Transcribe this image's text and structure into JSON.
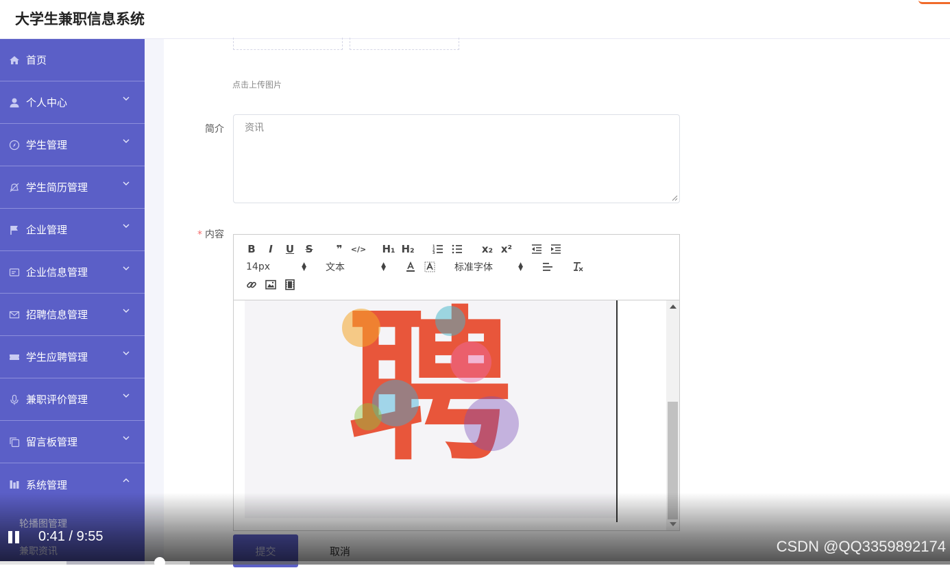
{
  "app": {
    "title": "大学生兼职信息系统"
  },
  "sidebar": {
    "items": [
      {
        "label": "首页",
        "icon": "home-icon",
        "expandable": false
      },
      {
        "label": "个人中心",
        "icon": "user-icon",
        "expandable": true
      },
      {
        "label": "学生管理",
        "icon": "compass-icon",
        "expandable": true
      },
      {
        "label": "学生简历管理",
        "icon": "bell-off-icon",
        "expandable": true
      },
      {
        "label": "企业管理",
        "icon": "flag-icon",
        "expandable": true
      },
      {
        "label": "企业信息管理",
        "icon": "id-card-icon",
        "expandable": true
      },
      {
        "label": "招聘信息管理",
        "icon": "mail-icon",
        "expandable": true
      },
      {
        "label": "学生应聘管理",
        "icon": "ticket-icon",
        "expandable": true
      },
      {
        "label": "兼职评价管理",
        "icon": "microphone-icon",
        "expandable": true
      },
      {
        "label": "留言板管理",
        "icon": "copy-icon",
        "expandable": true
      },
      {
        "label": "系统管理",
        "icon": "chart-icon",
        "expandable": true,
        "expanded": true
      }
    ],
    "subitems": [
      "轮播图管理",
      "兼职资讯"
    ]
  },
  "form": {
    "upload_hint": "点击上传图片",
    "intro_label": "简介",
    "intro_value": "资讯",
    "content_required_mark": "*",
    "content_label": "内容",
    "submit_label": "提交",
    "cancel_label": "取消"
  },
  "editor": {
    "font_size": "14px",
    "heading": "文本",
    "font_family": "标准字体",
    "buttons": {
      "bold": "B",
      "italic": "I",
      "underline": "U",
      "strike": "S",
      "quote": "❞",
      "code": "</>",
      "h1": "H₁",
      "h2": "H₂",
      "sub": "x₂",
      "sup": "x²"
    },
    "image_char": "聘"
  },
  "video": {
    "time": "0:41 / 9:55",
    "played_fraction": 0.07,
    "buffered_fraction": 0.2,
    "watermark": "CSDN @QQ3359892174"
  },
  "colors": {
    "sidebar": "#5b5fc7",
    "accent": "#5b5fc7",
    "required": "#f56c6c"
  }
}
